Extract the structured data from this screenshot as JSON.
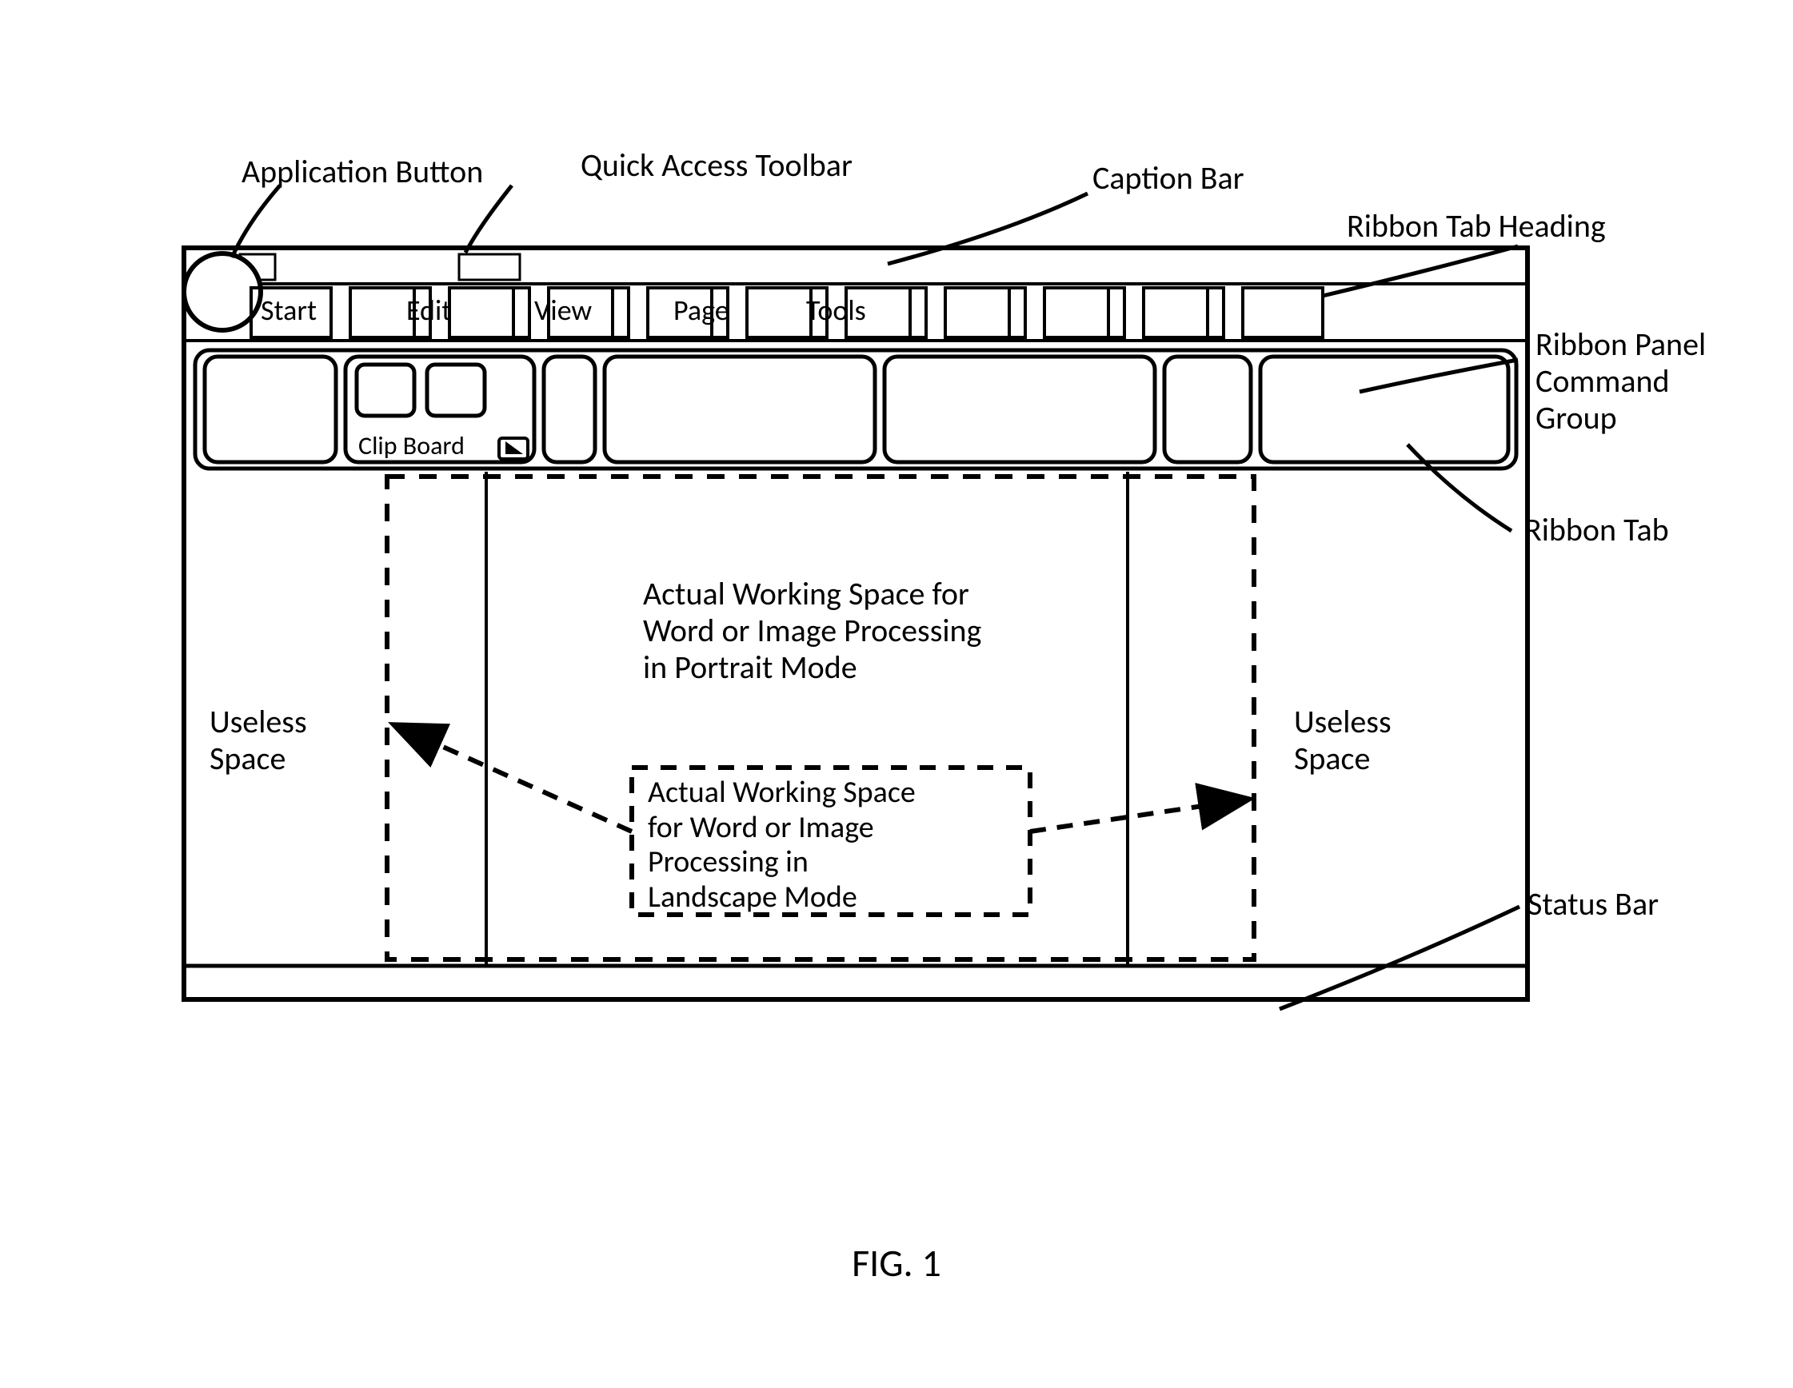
{
  "callouts": {
    "application_button": "Application Button",
    "quick_access_toolbar": "Quick Access Toolbar",
    "caption_bar": "Caption Bar",
    "ribbon_tab_heading": "Ribbon Tab Heading",
    "ribbon_panel_command_group": "Ribbon Panel\nCommand\nGroup",
    "ribbon_tab": "Ribbon Tab",
    "status_bar": "Status Bar",
    "useless_left": "Useless\nSpace",
    "useless_right": "Useless\nSpace"
  },
  "tabs": {
    "t1": "Start",
    "t2": "Edit",
    "t3": "View",
    "t4": "Page",
    "t5": "Tools"
  },
  "panel_group_label": "Clip Board",
  "workspace_portrait": "Actual Working Space for\nWord or Image Processing\nin Portrait Mode",
  "workspace_landscape": "Actual Working Space\nfor Word or Image\nProcessing in\nLandscape Mode",
  "figure_caption": "FIG. 1"
}
